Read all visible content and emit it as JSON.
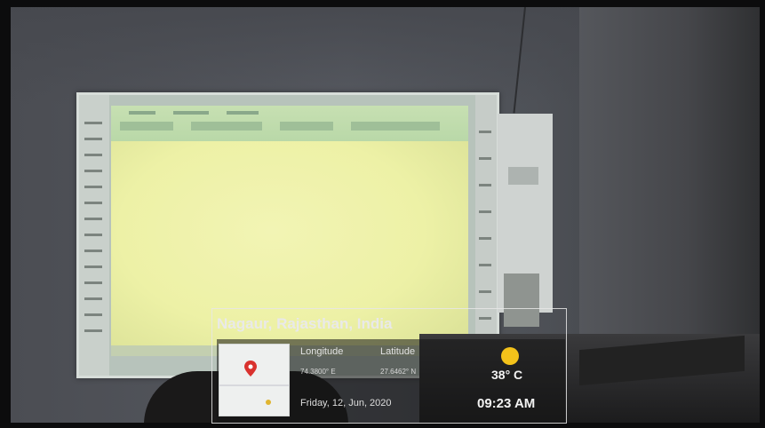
{
  "overlay": {
    "location": "Nagaur, Rajasthan, India",
    "longitude_label": "Longitude",
    "latitude_label": "Latitude",
    "longitude_value": "74.3800° E",
    "latitude_value": "27.6462° N",
    "date": "Friday, 12, Jun, 2020",
    "temperature": "38° C",
    "time": "09:23 AM",
    "weather_icon": "sun-icon"
  },
  "colors": {
    "screen": "#edf1a6",
    "ribbon": "#c7e0b2",
    "sun": "#f3c21a",
    "pin": "#d9322e"
  }
}
